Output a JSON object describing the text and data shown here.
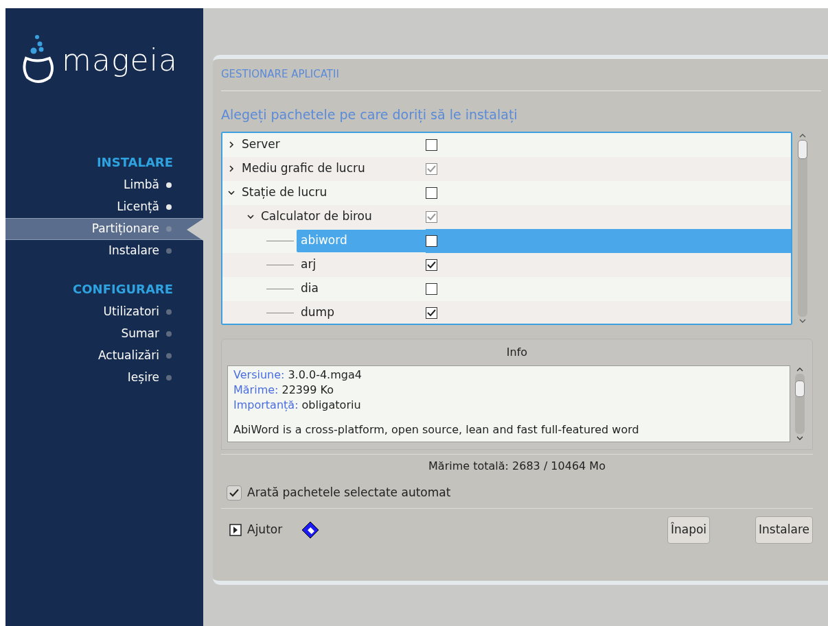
{
  "logo": {
    "text": "mageia"
  },
  "sidebar": {
    "sections": [
      {
        "title": "INSTALARE",
        "items": [
          {
            "label": "Limbă",
            "done": true,
            "selected": false
          },
          {
            "label": "Licență",
            "done": true,
            "selected": false
          },
          {
            "label": "Partiționare",
            "done": false,
            "selected": true
          },
          {
            "label": "Instalare",
            "done": false,
            "selected": false
          }
        ]
      },
      {
        "title": "CONFIGURARE",
        "items": [
          {
            "label": "Utilizatori",
            "done": false,
            "selected": false
          },
          {
            "label": "Sumar",
            "done": false,
            "selected": false
          },
          {
            "label": "Actualizări",
            "done": false,
            "selected": false
          },
          {
            "label": "Ieșire",
            "done": false,
            "selected": false
          }
        ]
      }
    ]
  },
  "dialog": {
    "title": "GESTIONARE APLICAȚII",
    "subtitle": "Alegeți pachetele pe care doriți să le instalați",
    "tree": [
      {
        "label": "Server",
        "expanded": false,
        "checked": false,
        "mixed": false,
        "selected": false
      },
      {
        "label": "Mediu grafic de lucru",
        "expanded": false,
        "checked": true,
        "mixed": true,
        "selected": false
      },
      {
        "label": "Stație de lucru",
        "expanded": true,
        "checked": false,
        "mixed": false,
        "selected": false,
        "children": [
          {
            "label": "Calculator de birou",
            "expanded": true,
            "checked": true,
            "mixed": true,
            "selected": false,
            "children": [
              {
                "label": "abiword",
                "checked": false,
                "mixed": false,
                "selected": true
              },
              {
                "label": "arj",
                "checked": true,
                "mixed": false,
                "selected": false
              },
              {
                "label": "dia",
                "checked": false,
                "mixed": false,
                "selected": false
              },
              {
                "label": "dump",
                "checked": true,
                "mixed": false,
                "selected": false
              }
            ]
          }
        ]
      }
    ],
    "info": {
      "title": "Info",
      "fields": [
        {
          "label": "Versiune:",
          "value": "3.0.0-4.mga4"
        },
        {
          "label": "Mărime:",
          "value": "22399 Ko"
        },
        {
          "label": "Importanță:",
          "value": "obligatoriu"
        }
      ],
      "description": "AbiWord is a cross-platform, open source, lean and fast full-featured word"
    },
    "total": "Mărime totală: 2683 / 10464 Mo",
    "auto_select": {
      "label": "Arată pachetele selectate automat",
      "checked": true
    },
    "help": {
      "label": "Ajutor"
    },
    "buttons": [
      "Înapoi",
      "Instalare"
    ]
  }
}
